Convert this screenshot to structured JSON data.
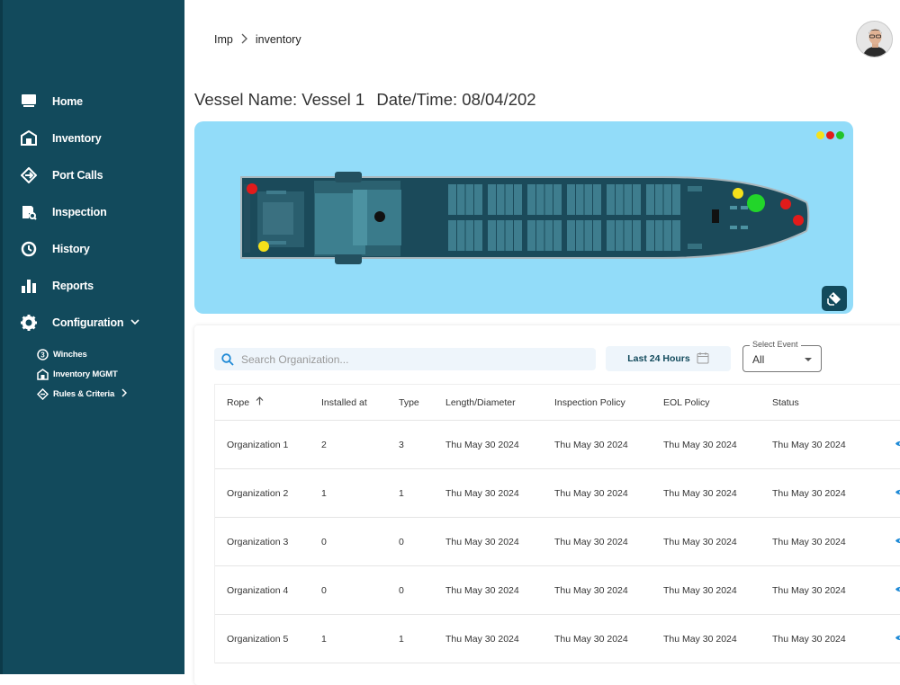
{
  "sidebar": {
    "items": [
      {
        "label": "Home",
        "icon": "monitor-icon"
      },
      {
        "label": "Inventory",
        "icon": "warehouse-icon"
      },
      {
        "label": "Port Calls",
        "icon": "route-icon"
      },
      {
        "label": "Inspection",
        "icon": "inspection-icon"
      },
      {
        "label": "History",
        "icon": "history-icon"
      },
      {
        "label": "Reports",
        "icon": "bar-chart-icon"
      },
      {
        "label": "Configuration",
        "icon": "gear-icon"
      }
    ],
    "sub_items": [
      {
        "label": "Winches",
        "icon": "winch-icon"
      },
      {
        "label": "Inventory MGMT",
        "icon": "warehouse-icon"
      },
      {
        "label": "Rules & Criteria",
        "icon": "route-icon"
      }
    ]
  },
  "breadcrumb": {
    "root": "Imp",
    "current": "inventory"
  },
  "header": {
    "vessel": "Vessel Name: Vessel 1",
    "datetime": "Date/Time: 08/04/202"
  },
  "vessel_panel": {
    "background": "#92dcf9",
    "status_colors": [
      "#f5e11b",
      "#e11b1b",
      "#22c32a"
    ]
  },
  "filters": {
    "search_placeholder": "Search Organization...",
    "range_label": "Last 24 Hours",
    "select_legend": "Select Event",
    "select_value": "All"
  },
  "table": {
    "columns": [
      "Rope",
      "Installed at",
      "Type",
      "Length/Diameter",
      "Inspection Policy",
      "EOL Policy",
      "Status"
    ],
    "rows": [
      [
        "Organization 1",
        "2",
        "3",
        "Thu May 30 2024",
        "Thu May 30 2024",
        "Thu May 30 2024",
        "Thu May 30 2024"
      ],
      [
        "Organization 2",
        "1",
        "1",
        "Thu May 30 2024",
        "Thu May 30 2024",
        "Thu May 30 2024",
        "Thu May 30 2024"
      ],
      [
        "Organization 3",
        "0",
        "0",
        "Thu May 30 2024",
        "Thu May 30 2024",
        "Thu May 30 2024",
        "Thu May 30 2024"
      ],
      [
        "Organization 4",
        "0",
        "0",
        "Thu May 30 2024",
        "Thu May 30 2024",
        "Thu May 30 2024",
        "Thu May 30 2024"
      ],
      [
        "Organization 5",
        "1",
        "1",
        "Thu May 30 2024",
        "Thu May 30 2024",
        "Thu May 30 2024",
        "Thu May 30 2024"
      ]
    ]
  },
  "colors": {
    "sidebar": "#124a5c",
    "accent": "#1f8ad6"
  }
}
